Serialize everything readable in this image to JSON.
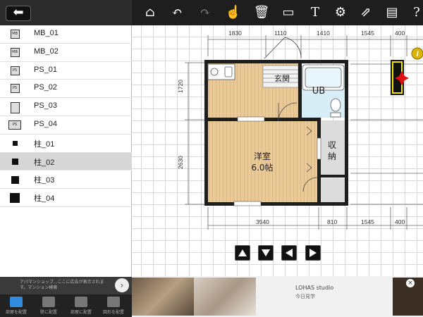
{
  "left_panel": {
    "parts": [
      {
        "label": "MB_01",
        "thumb": "mb"
      },
      {
        "label": "MB_02",
        "thumb": "mb"
      },
      {
        "label": "PS_01",
        "thumb": "ps"
      },
      {
        "label": "PS_02",
        "thumb": "ps"
      },
      {
        "label": "PS_03",
        "thumb": "ps3"
      },
      {
        "label": "PS_04",
        "thumb": "ps4"
      },
      {
        "label": "柱_01",
        "thumb": "col1"
      },
      {
        "label": "柱_02",
        "thumb": "col2"
      },
      {
        "label": "柱_03",
        "thumb": "col3"
      },
      {
        "label": "柱_04",
        "thumb": "col4"
      }
    ],
    "selected_index": 7,
    "thumb_text": {
      "mb": "MB",
      "ps": "PS",
      "ps4": "PS"
    },
    "ad_text": "アパマンショップ...ここに広告が表示されます。マンション検索",
    "tabs": [
      {
        "label": "部屋を配置",
        "icon": "room-icon",
        "color": "#2f8ce0"
      },
      {
        "label": "壁に配置",
        "icon": "wall-icon",
        "color": "#777777"
      },
      {
        "label": "部屋に配置",
        "icon": "furniture-icon",
        "color": "#777777"
      },
      {
        "label": "図形を配置",
        "icon": "shape-icon",
        "color": "#777777"
      }
    ]
  },
  "toolbar": {
    "tools": [
      {
        "name": "home-icon",
        "glyph": "⌂"
      },
      {
        "name": "undo-icon",
        "glyph": "↶"
      },
      {
        "name": "redo-icon",
        "glyph": "↷"
      },
      {
        "name": "select-icon",
        "glyph": "☝"
      },
      {
        "name": "trash-icon",
        "glyph": "🗑"
      },
      {
        "name": "measure-icon",
        "glyph": "▭"
      },
      {
        "name": "text-icon",
        "glyph": "T"
      },
      {
        "name": "settings-icon",
        "glyph": "⚙"
      },
      {
        "name": "share-icon",
        "glyph": "⇗"
      },
      {
        "name": "floorplan-icon",
        "glyph": "▤"
      },
      {
        "name": "help-icon",
        "glyph": "?"
      }
    ]
  },
  "plan": {
    "top_dims": [
      "1830",
      "1110",
      "1410",
      "1545",
      "400"
    ],
    "bottom_dims": [
      "3540",
      "810",
      "1545",
      "400"
    ],
    "left_dims": [
      "1720",
      "2630"
    ],
    "rooms": {
      "entrance": "玄関",
      "bath": "UB",
      "storage_line1": "収",
      "storage_line2": "納",
      "western_room_line1": "洋室",
      "western_room_line2": "6.0帖"
    },
    "info_badge": "i"
  },
  "nav": {
    "up": "▲",
    "down": "▼",
    "left": "◀",
    "right": "▶"
  },
  "ad_bottom": {
    "title": "LOHAS studio",
    "subtitle": "今日見学",
    "close": "×"
  },
  "colors": {
    "floor": "#e9c998",
    "wall": "#1e1e1e",
    "bath": "#d7eef6",
    "storage": "#dcdcdc",
    "selected_row": "#d6d6d6"
  }
}
